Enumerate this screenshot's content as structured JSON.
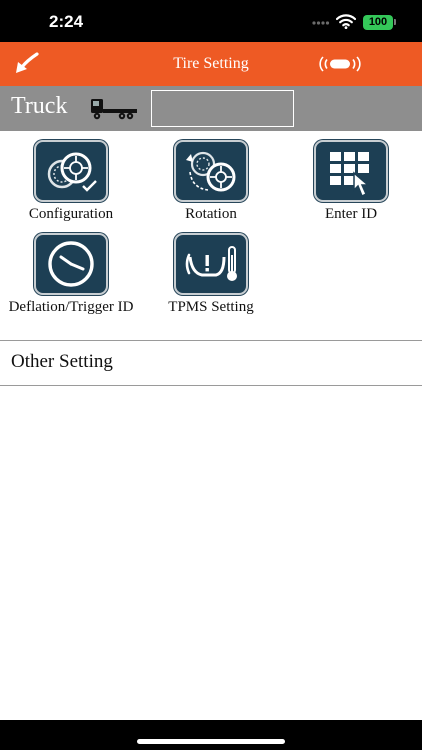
{
  "status_bar": {
    "time": "2:24",
    "battery": "100"
  },
  "nav": {
    "title": "Tire Setting",
    "back_icon": "back-arrow-icon",
    "right_icon": "tpms-signal-icon"
  },
  "vehicle": {
    "type_label": "Truck",
    "icon": "truck-icon",
    "id_value": ""
  },
  "menu": {
    "items": [
      {
        "label": "Configuration",
        "icon": "tire-configuration-icon"
      },
      {
        "label": "Rotation",
        "icon": "tire-rotation-icon"
      },
      {
        "label": "Enter ID",
        "icon": "keypad-touch-icon"
      },
      {
        "label": "Deflation/Trigger ID",
        "icon": "clock-icon"
      },
      {
        "label": "TPMS Setting",
        "icon": "tpms-warning-icon"
      }
    ]
  },
  "other_setting": {
    "label": "Other Setting"
  },
  "colors": {
    "nav_bar": "#ee5a24",
    "vehicle_bar": "#8e8e8e",
    "tile": "#1d3f54",
    "battery": "#34c759"
  }
}
